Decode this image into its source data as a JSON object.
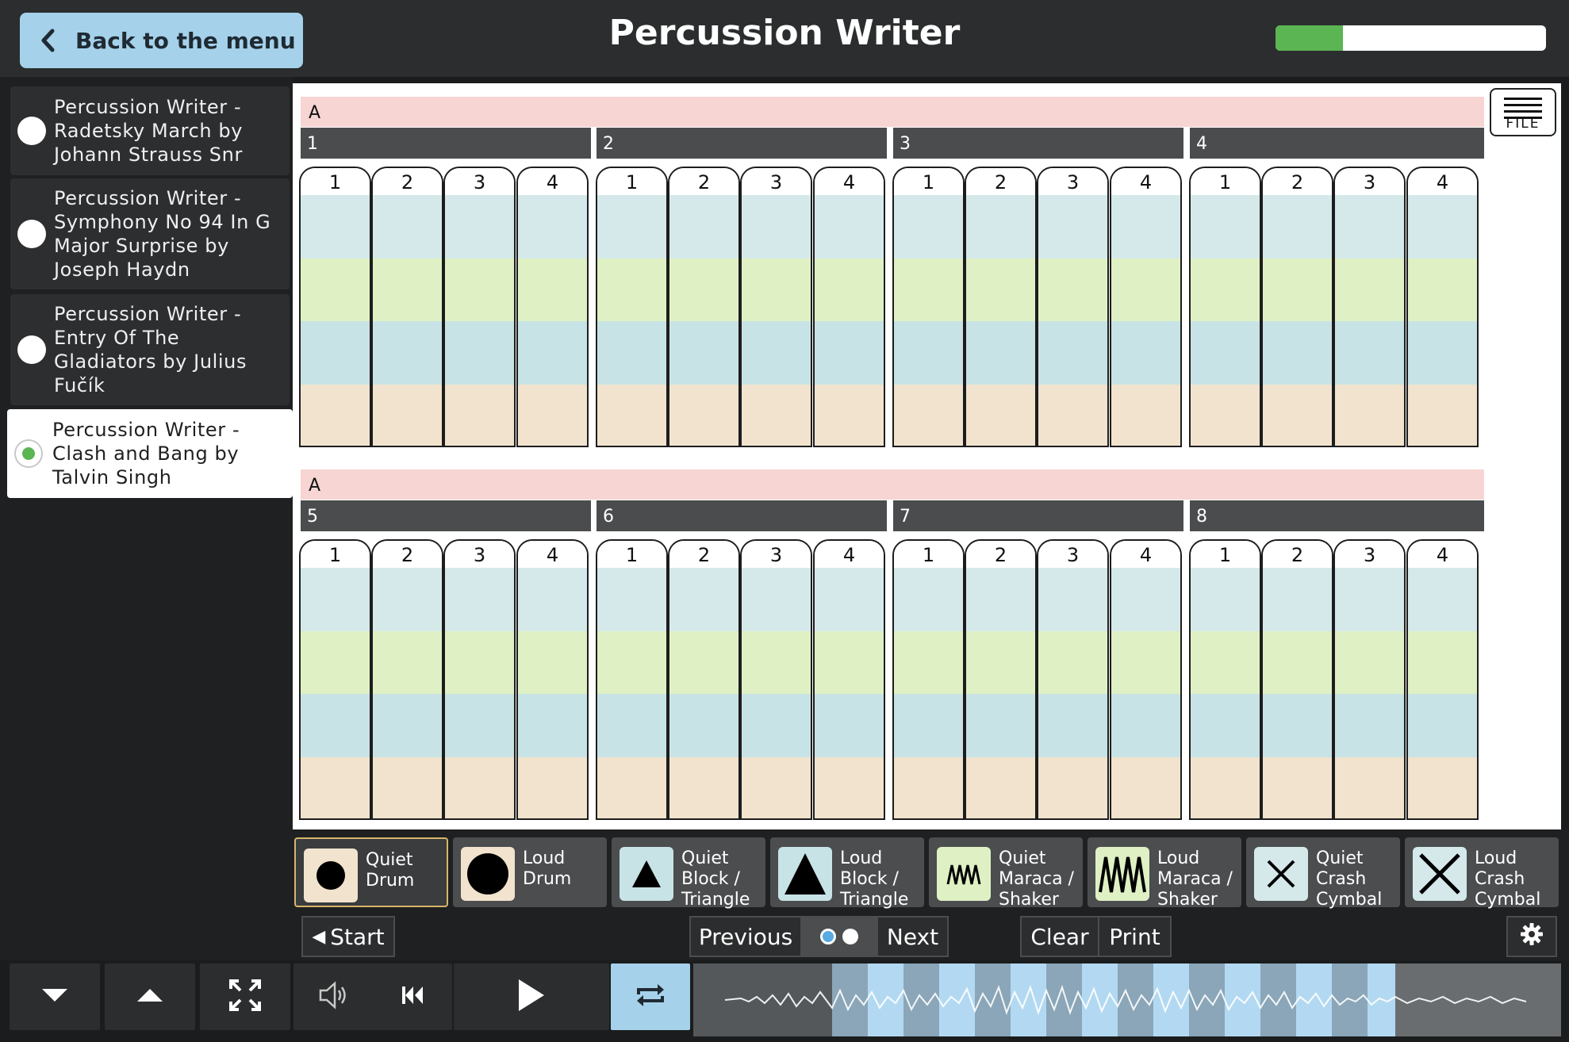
{
  "header": {
    "back_label": "Back to the menu",
    "title": "Percussion Writer",
    "progress_fraction": 0.25
  },
  "sidebar": {
    "items": [
      {
        "label": "Percussion Writer - Radetsky March by Johann Strauss Snr",
        "selected": false
      },
      {
        "label": "Percussion Writer - Symphony No 94 In G Major Surprise by Joseph Haydn",
        "selected": false
      },
      {
        "label": "Percussion Writer - Entry Of The Gladiators by Julius Fučík",
        "selected": false
      },
      {
        "label": "Percussion Writer - Clash and Bang by Talvin Singh",
        "selected": true
      }
    ]
  },
  "score": {
    "file_label": "FILE",
    "systems": [
      {
        "section": "A",
        "bars": [
          "1",
          "2",
          "3",
          "4"
        ]
      },
      {
        "section": "A",
        "bars": [
          "5",
          "6",
          "7",
          "8"
        ]
      }
    ],
    "beats": [
      "1",
      "2",
      "3",
      "4"
    ],
    "row_colors": [
      "#d5e9ea",
      "#dff1c4",
      "#c8e3e5",
      "#f1e3cd"
    ]
  },
  "instruments": [
    {
      "label": "Quiet Drum",
      "icon": "small-circle-icon",
      "tile_color": "#f1e3cd",
      "selected": true
    },
    {
      "label": "Loud Drum",
      "icon": "large-circle-icon",
      "tile_color": "#f1e3cd",
      "selected": false
    },
    {
      "label": "Quiet Block / Triangle",
      "icon": "small-triangle-icon",
      "tile_color": "#c8e3e5",
      "selected": false
    },
    {
      "label": "Loud Block / Triangle",
      "icon": "large-triangle-icon",
      "tile_color": "#c8e3e5",
      "selected": false
    },
    {
      "label": "Quiet Maraca / Shaker",
      "icon": "small-zigzag-icon",
      "tile_color": "#dff1c4",
      "selected": false
    },
    {
      "label": "Loud Maraca / Shaker",
      "icon": "large-zigzag-icon",
      "tile_color": "#dff1c4",
      "selected": false
    },
    {
      "label": "Quiet Crash Cymbal",
      "icon": "small-cross-icon",
      "tile_color": "#d5e9ea",
      "selected": false
    },
    {
      "label": "Loud Crash Cymbal",
      "icon": "large-cross-icon",
      "tile_color": "#d5e9ea",
      "selected": false
    }
  ],
  "controls": {
    "start_label": "Start",
    "previous_label": "Previous",
    "next_label": "Next",
    "clear_label": "Clear",
    "print_label": "Print"
  },
  "transport": {
    "icons": [
      "chevron-down-icon",
      "chevron-up-icon",
      "fullscreen-icon",
      "volume-icon",
      "skip-back-icon",
      "play-icon",
      "loop-icon"
    ]
  },
  "colors": {
    "accent": "#a5d1ea",
    "progress": "#5bb552",
    "section_bar": "#f6d5d3",
    "selected_border": "#d9b56a"
  }
}
